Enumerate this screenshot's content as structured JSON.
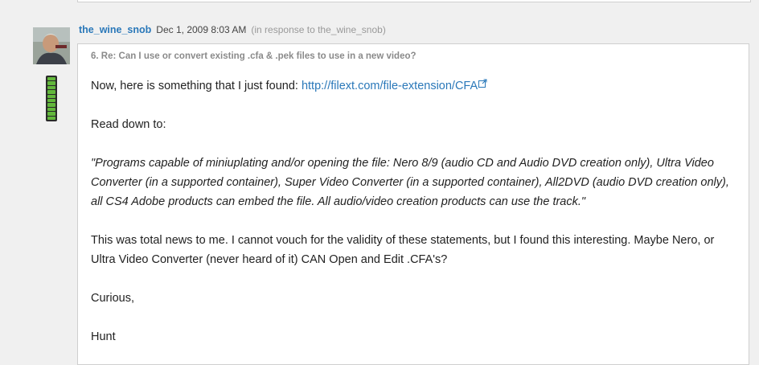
{
  "post": {
    "author": "the_wine_snob",
    "date": "Dec 1, 2009 8:03 AM",
    "in_response_to": "(in response to the_wine_snob)",
    "subject": "6. Re: Can I use or convert existing .cfa & .pek files to use in a new video?",
    "body": {
      "line1_text": "Now, here is something that I just found: ",
      "line1_link": "http://filext.com/file-extension/CFA",
      "line2": "Read down to:",
      "quote": "\"Programs capable of miniuplating and/or opening the file: Nero 8/9 (audio CD and  Audio DVD creation only), Ultra Video Converter (in a supported container),  Super Video Converter (in a supported container), All2DVD (audio DVD creation  only), all CS4 Adobe products can embed the file. All audio/video creation  products can use the track.\"",
      "para": "This was total news to me. I cannot vouch for the validity of these statements, but I found this interesting. Maybe Nero, or Ultra Video Converter (never heard of it) CAN Open and Edit .CFA's?",
      "closing": "Curious,",
      "signature": "Hunt"
    }
  },
  "icons": {
    "avatar": "user-avatar-photo",
    "status": "status-level-meter-icon",
    "external_link": "external-link-icon"
  },
  "colors": {
    "link": "#2a78b9",
    "meter": "#63b83c"
  }
}
